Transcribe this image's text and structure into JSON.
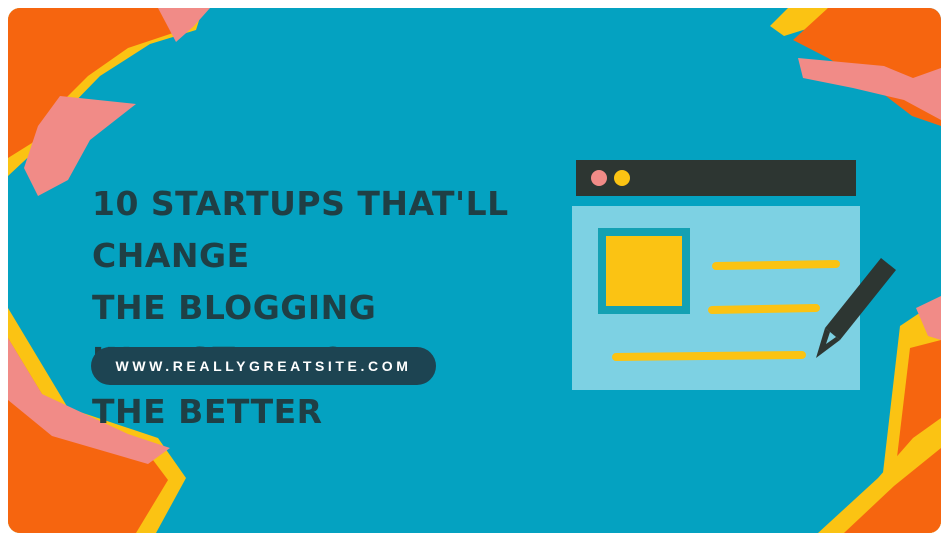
{
  "slide": {
    "headline_lines": [
      "10 STARTUPS THAT'LL CHANGE",
      "THE BLOGGING INDUSTRY FOR",
      "THE BETTER"
    ],
    "url": "WWW.REALLYGREATSITE.COM"
  },
  "colors": {
    "background": "#04a2c1",
    "orange": "#f6650f",
    "pink": "#f18b87",
    "yellow": "#fbc313",
    "navy": "#1d4452",
    "text_dark": "#1f3f45",
    "browser_panel": "#7dd1e3",
    "browser_bar": "#2d3632"
  },
  "illustration": {
    "name": "browser-window-with-pencil",
    "icons": [
      "browser-window-icon",
      "image-placeholder-icon",
      "pencil-icon"
    ]
  }
}
